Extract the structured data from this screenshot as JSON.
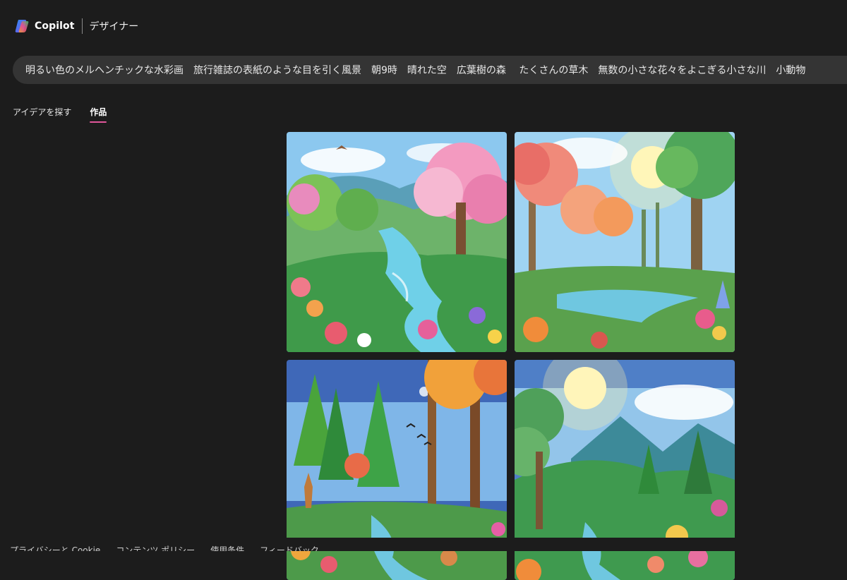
{
  "header": {
    "brand": "Copilot",
    "product": "デザイナー"
  },
  "prompt": {
    "text": "明るい色のメルヘンチックな水彩画　旅行雑誌の表紙のような目を引く風景　朝9時　晴れた空　広葉樹の森　 たくさんの草木　無数の小さな花々をよこぎる小さな川　小動物"
  },
  "tabs": [
    {
      "label": "アイデアを探す",
      "active": false
    },
    {
      "label": "作品",
      "active": true
    }
  ],
  "images": [
    {
      "subject": "forest-river-pink-tree"
    },
    {
      "subject": "forest-sunburst-stream"
    },
    {
      "subject": "pine-forest-deer-birds"
    },
    {
      "subject": "mountain-valley-sun"
    }
  ],
  "footer": {
    "links": [
      "プライバシーと Cookie",
      "コンテンツ ポリシー",
      "使用条件",
      "フィードバック"
    ]
  },
  "colors": {
    "background": "#1c1c1c",
    "prompt_bar": "#343434",
    "tab_accent": "#e0569a"
  }
}
